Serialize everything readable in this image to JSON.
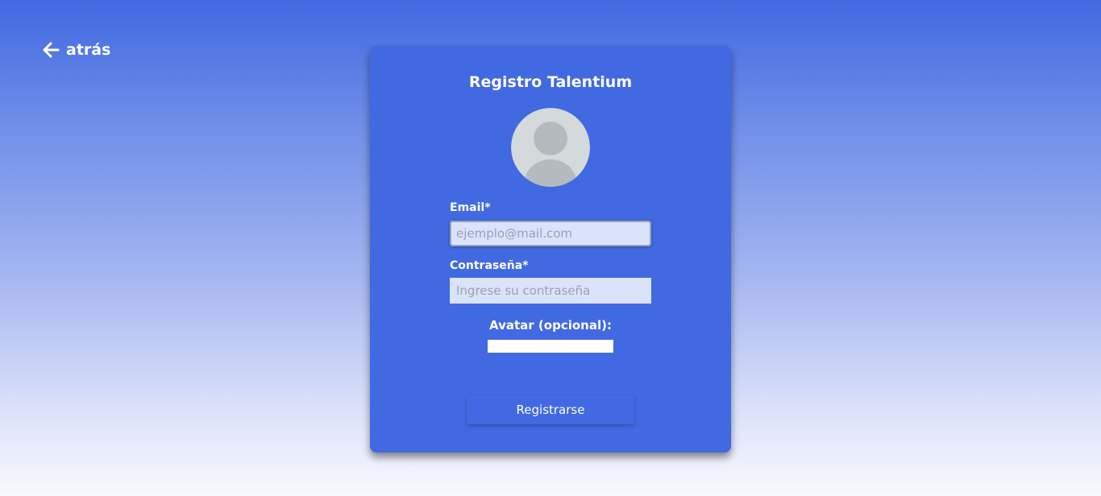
{
  "nav": {
    "back_label": "atrás",
    "back_icon": "arrow-left-icon"
  },
  "form": {
    "title": "Registro Talentium",
    "avatar_icon": "user-placeholder-icon",
    "email_label": "Email*",
    "email_placeholder": "ejemplo@mail.com",
    "email_value": "",
    "password_label": "Contraseña*",
    "password_placeholder": "Ingrese su contraseña",
    "password_value": "",
    "avatar_label": "Avatar (opcional):",
    "submit_label": "Registrarse"
  },
  "colors": {
    "primary": "#4169e1",
    "input_bg": "#dbe3fa",
    "avatar_bg": "#d4d9dc",
    "avatar_silhouette": "#b3bbbe"
  }
}
